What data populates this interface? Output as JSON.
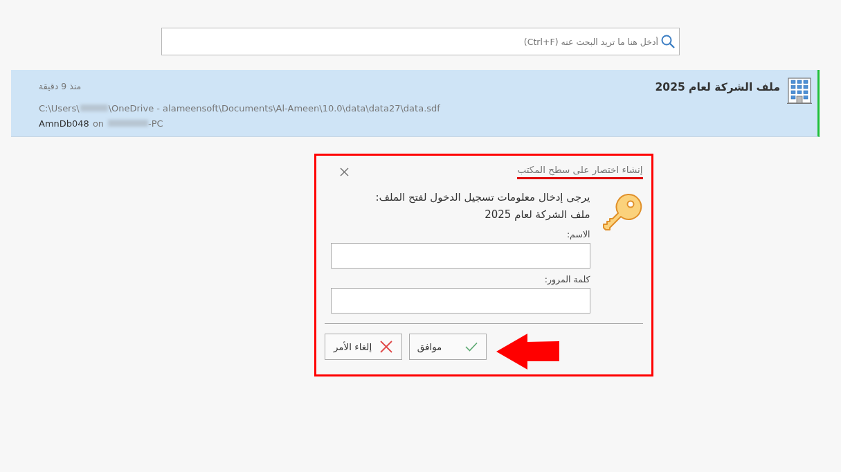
{
  "search": {
    "placeholder": "أدخل هنا ما تريد البحث عنه (Ctrl+F)"
  },
  "files": [
    {
      "title": "ملف الشركة لعام 2025",
      "time": "منذ 9 دقيقة",
      "path_start": "C:\\Users\\",
      "path_end": "\\OneDrive - alameensoft\\Documents\\Al-Ameen\\10.0\\data\\data27\\data.sdf",
      "database": "AmnDb048",
      "on": "on",
      "machine_suffix": "-PC",
      "selected": true
    }
  ],
  "dialog": {
    "title": "إنشاء اختصار على سطح المكتب",
    "message": "يرجى إدخال معلومات تسجيل الدخول لفتح الملف:",
    "file_name": "ملف الشركة لعام 2025",
    "fields": [
      {
        "label": "الاسم:"
      },
      {
        "label": "كلمة المرور:"
      }
    ],
    "buttons": [
      {
        "label": "موافق",
        "kind": "ok"
      },
      {
        "label": "إلغاء الأمر",
        "kind": "cancel"
      }
    ]
  }
}
